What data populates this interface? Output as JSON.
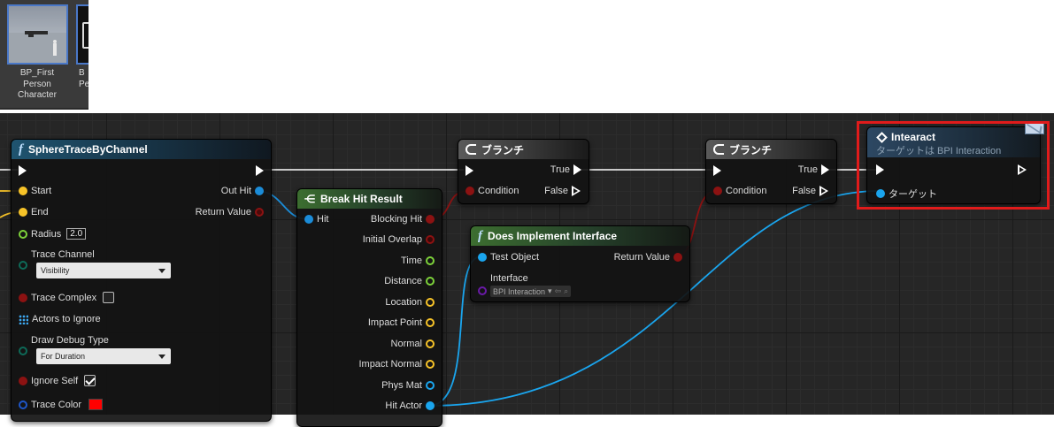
{
  "content_browser": {
    "assets": [
      {
        "name": "BP_First Person Character",
        "name_lines": [
          "BP_First",
          "Person",
          "Character"
        ]
      },
      {
        "name_lines": [
          "B",
          "Pe"
        ]
      }
    ]
  },
  "nodes": {
    "sphere_trace": {
      "title": "SphereTraceByChannel",
      "inputs": {
        "start": "Start",
        "end": "End",
        "radius": "Radius",
        "radius_value": "2.0",
        "trace_channel": "Trace Channel",
        "trace_channel_value": "Visibility",
        "trace_complex": "Trace Complex",
        "actors_to_ignore": "Actors to Ignore",
        "draw_debug_type": "Draw Debug Type",
        "draw_debug_value": "For Duration",
        "ignore_self": "Ignore Self",
        "trace_color": "Trace Color"
      },
      "outputs": {
        "out_hit": "Out Hit",
        "return_value": "Return Value"
      }
    },
    "break_hit": {
      "title": "Break Hit Result",
      "input": "Hit",
      "outputs": [
        "Blocking Hit",
        "Initial Overlap",
        "Time",
        "Distance",
        "Location",
        "Impact Point",
        "Normal",
        "Impact Normal",
        "Phys Mat",
        "Hit Actor"
      ]
    },
    "branch1": {
      "title": "ブランチ",
      "condition": "Condition",
      "true": "True",
      "false": "False"
    },
    "branch2": {
      "title": "ブランチ",
      "condition": "Condition",
      "true": "True",
      "false": "False"
    },
    "does_implement": {
      "title": "Does Implement Interface",
      "test_object": "Test Object",
      "return_value": "Return Value",
      "interface": "Interface",
      "interface_value": "BPI Interaction"
    },
    "interact": {
      "title": "Intearact",
      "subtitle": "ターゲットは BPI Interaction",
      "target": "ターゲット"
    }
  },
  "colors": {
    "exec": "#ffffff",
    "vector": "#f7c328",
    "float": "#7dd23a",
    "byte": "#0e6a58",
    "bool": "#8c1212",
    "struct": "#1b8cd8",
    "object": "#1aa5ee",
    "linear_color": "#1e56c8",
    "highlight": "#e01b1b"
  }
}
